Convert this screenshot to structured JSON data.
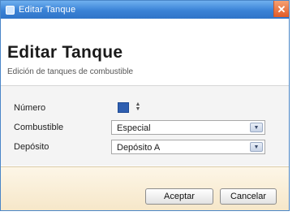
{
  "window": {
    "title": "Editar Tanque",
    "close_glyph": "✕"
  },
  "header": {
    "title": "Editar Tanque",
    "subtitle": "Edición de tanques de combustible"
  },
  "form": {
    "numero": {
      "label": "Número",
      "value": "",
      "spin_up": "▲",
      "spin_down": "▼"
    },
    "combustible": {
      "label": "Combustible",
      "value": "Especial",
      "arrow": "▼"
    },
    "deposito": {
      "label": "Depósito",
      "value": "Depósito A",
      "arrow": "▼"
    }
  },
  "footer": {
    "accept_label": "Aceptar",
    "cancel_label": "Cancelar"
  },
  "colors": {
    "titlebar": "#3a82d6",
    "close_button": "#e05a27",
    "footer": "#f8ebd0"
  }
}
